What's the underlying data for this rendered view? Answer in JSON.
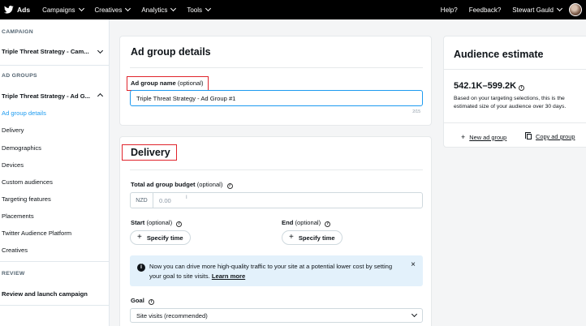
{
  "topbar": {
    "brand": "Ads",
    "nav": [
      "Campaigns",
      "Creatives",
      "Analytics",
      "Tools"
    ],
    "help": "Help?",
    "feedback": "Feedback?",
    "user": "Stewart Gauld"
  },
  "sidebar": {
    "campaign_header": "CAMPAIGN",
    "campaign_name": "Triple Threat Strategy - Cam...",
    "ad_groups_header": "AD GROUPS",
    "ad_group_name": "Triple Threat Strategy - Ad G...",
    "items": [
      "Ad group details",
      "Delivery",
      "Demographics",
      "Devices",
      "Custom audiences",
      "Targeting features",
      "Placements",
      "Twitter Audience Platform",
      "Creatives"
    ],
    "review_header": "REVIEW",
    "review_link": "Review and launch campaign"
  },
  "ad_group_details": {
    "title": "Ad group details",
    "name_label": "Ad group name",
    "name_optional": "(optional)",
    "name_value": "Triple Threat Strategy - Ad Group #1",
    "counter": "2/15"
  },
  "delivery": {
    "title": "Delivery",
    "budget_label": "Total ad group budget",
    "budget_optional": "(optional)",
    "currency": "NZD",
    "budget_placeholder": "0.00",
    "start_label": "Start",
    "start_optional": "(optional)",
    "start_button": "Specify time",
    "end_label": "End",
    "end_optional": "(optional)",
    "end_button": "Specify time",
    "notice_text": "Now you can drive more high-quality traffic to your site at a potential lower cost by setting your goal to site visits. ",
    "notice_link": "Learn more",
    "goal_label": "Goal",
    "goal_value": "Site visits (recommended)"
  },
  "audience_estimate": {
    "title": "Audience estimate",
    "range": "542.1K–599.2K",
    "description": "Based on your targeting selections, this is the estimated size of your audience over 30 days.",
    "new_ad_group": "New ad group",
    "copy_ad_group": "Copy ad group"
  },
  "colors": {
    "accent": "#1d9bf0",
    "highlight_box": "#e0242c",
    "notice_bg": "#e3f1fb"
  }
}
